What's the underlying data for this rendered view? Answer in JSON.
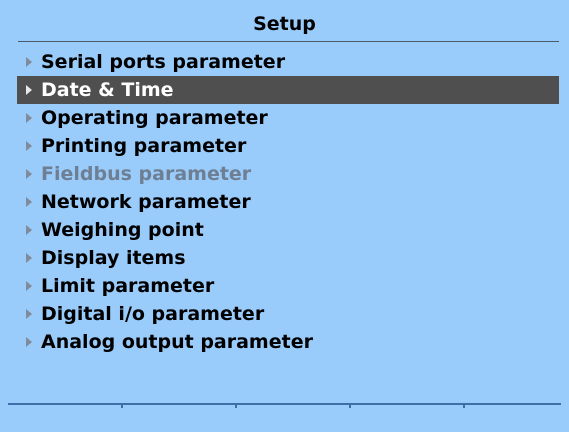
{
  "header": {
    "title": "Setup"
  },
  "menu": {
    "selected_index": 1,
    "items": [
      {
        "label": "Serial ports parameter",
        "state": "normal"
      },
      {
        "label": "Date & Time",
        "state": "selected"
      },
      {
        "label": "Operating parameter",
        "state": "normal"
      },
      {
        "label": "Printing parameter",
        "state": "normal"
      },
      {
        "label": "Fieldbus parameter",
        "state": "disabled"
      },
      {
        "label": "Network parameter",
        "state": "normal"
      },
      {
        "label": "Weighing point",
        "state": "normal"
      },
      {
        "label": "Display items",
        "state": "normal"
      },
      {
        "label": "Limit parameter",
        "state": "normal"
      },
      {
        "label": "Digital i/o parameter",
        "state": "normal"
      },
      {
        "label": "Analog output parameter",
        "state": "normal"
      }
    ]
  },
  "icons": {
    "menu_item_marker": "right-triangle-icon"
  },
  "colors": {
    "background": "#99cbfb",
    "selection": "#4f4f4f",
    "disabled_text": "#6e7f93",
    "softkey_line": "#3e6fa8"
  }
}
